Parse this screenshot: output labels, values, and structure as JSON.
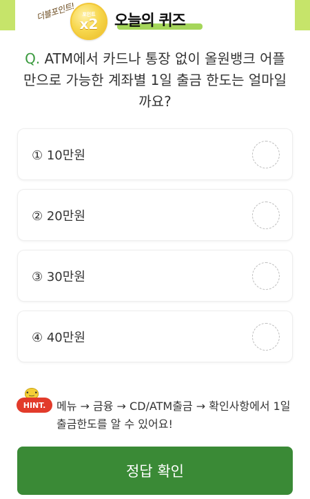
{
  "header": {
    "badge_text": "더블포인트!",
    "coin_top": "포인트",
    "coin_multiplier": "x2",
    "title": "오늘의 퀴즈"
  },
  "question": {
    "prefix": "Q.",
    "text": "ATM에서 카드나 통장 없이 올원뱅크 어플만으로 가능한 계좌별 1일 출금 한도는 얼마일까요?"
  },
  "options": [
    {
      "label": "① 10만원"
    },
    {
      "label": "② 20만원"
    },
    {
      "label": "③ 30만원"
    },
    {
      "label": "④ 40만원"
    }
  ],
  "hint": {
    "badge": "HINT.",
    "text": "메뉴 → 금융 → CD/ATM출금 → 확인사항에서 1일 출금한도를 알 수 있어요!"
  },
  "submit_label": "정답 확인",
  "colors": {
    "accent_green": "#3a8a36",
    "light_green": "#c6e46a",
    "hint_red": "#e23b2b",
    "coin_gold": "#f7d74d"
  }
}
